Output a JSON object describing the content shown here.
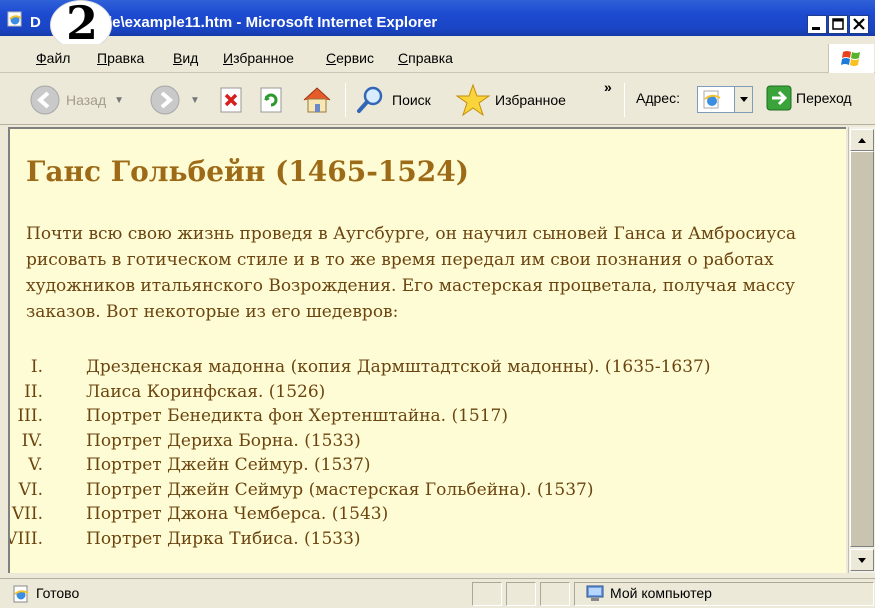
{
  "window": {
    "title_visible": "ple\\example11.htm - Microsoft Internet Explorer",
    "title_prefix": "D",
    "step_number": "2"
  },
  "menu": {
    "items": [
      "Файл",
      "Правка",
      "Вид",
      "Избранное",
      "Сервис",
      "Справка"
    ]
  },
  "toolbar": {
    "back_label": "Назад",
    "search_label": "Поиск",
    "favorites_label": "Избранное",
    "more_label": "»",
    "address_label": "Адрес:",
    "go_label": "Переход"
  },
  "page": {
    "heading": "Ганс Гольбейн (1465-1524)",
    "paragraph": "Почти всю свою жизнь проведя в Аугсбурге, он научил сыновей Ганса и Амбросиуса рисовать в готическом стиле и в то же время передал им свои познания о работах художников итальянского Возрождения. Его мастерская процветала, получая массу заказов. Вот некоторые из его шедевров:",
    "list": [
      {
        "num": "I.",
        "text": "Дрезденская мадонна (копия Дармштадтской мадонны). (1635-1637)"
      },
      {
        "num": "II.",
        "text": "Лаиса Коринфская. (1526)"
      },
      {
        "num": "III.",
        "text": "Портрет Бенедикта фон Хертенштайна. (1517)"
      },
      {
        "num": "IV.",
        "text": "Портрет Дериха Борна. (1533)"
      },
      {
        "num": "V.",
        "text": "Портрет Джейн Сеймур. (1537)"
      },
      {
        "num": "VI.",
        "text": "Портрет Джейн Сеймур (мастерская Гольбейна). (1537)"
      },
      {
        "num": "VII.",
        "text": "Портрет Джона Чемберса. (1543)"
      },
      {
        "num": "VIII.",
        "text": "Портрет Дирка Тибиса. (1533)"
      }
    ]
  },
  "status": {
    "left_text": "Готово",
    "zone_text": "Мой компьютер"
  },
  "colors": {
    "page_background": "#fefcd4",
    "heading": "#9d6a17",
    "body_text": "#6b4410",
    "titlebar": "#1c4ad0"
  }
}
